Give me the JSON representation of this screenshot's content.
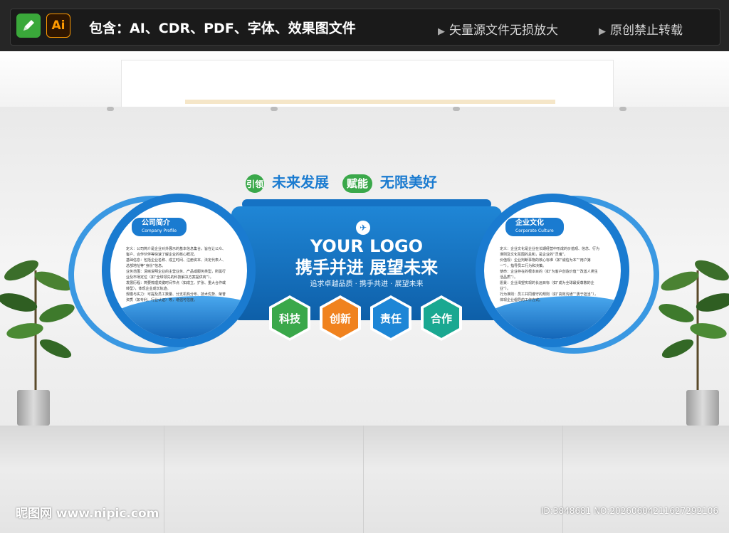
{
  "topbar": {
    "pen_icon": "pen-icon",
    "ai_label": "Ai",
    "contains": "包含：AI、CDR、PDF、字体、效果图文件",
    "feature1": "矢量源文件无损放大",
    "feature2": "原创禁止转载"
  },
  "headline": {
    "part1": "引领",
    "part2": "未来发展",
    "part3": "赋能",
    "part4": "无限美好"
  },
  "left_panel": {
    "title": "公司简介",
    "subtitle": "Company Profile",
    "lines": [
      "定义：公司简介是企业对外展示的基本信息集合，旨在让公众、",
      "客户、合作伙伴等快速了解企业的核心概况。",
      "基础信息：包括企业名称、成立时间、注册资本、法定代表人、",
      "总部地址等“身份”信息。",
      "业务范围：清晰说明企业的主营业务、产品或服务类型，所属行",
      "业及市场定位（如“全球领先的科技解决方案提供商”）。",
      "发展历程：简要梳理关键时间节点（如成立、扩张、重大合作或",
      "转型），体现企业成长轨迹。",
      "规模与实力：可提及员工数量、分支机构分布、技术优势、荣誉",
      "资质（如专利、行业认证）等，增强可信度。"
    ]
  },
  "right_panel": {
    "title": "企业文化",
    "subtitle": "Corporate Culture",
    "lines": [
      "定义：企业文化是企业在长期经营中形成的价值观、信念、行为",
      "准则及文化氛围的总和，是企业的“灵魂”。",
      "价值观：企业判断事物的核心标准（如“诚信为本”“用户第",
      "一”），指导员工行为和决策。",
      "使命：企业存在的根本目的（如“为客户创造价值”“改善人类生",
      "活品质”）。",
      "愿景：企业渴望实现的长远目标（如“成为全球最受尊敬的企",
      "业”）。",
      "行为准则：员工共同遵守的规则（如“高效沟通”“勇于担当”），",
      "体现企业倡导的工作方式。"
    ]
  },
  "center": {
    "logo_mark": "logo-icon",
    "logo": "YOUR LOGO",
    "slogan": "携手并进 展望未来",
    "sub": "追求卓越品质 · 携手共进 · 展望未来"
  },
  "values": [
    {
      "label": "科技",
      "color": "#3aa84a"
    },
    {
      "label": "创新",
      "color": "#f0821e"
    },
    {
      "label": "责任",
      "color": "#1d86d6"
    },
    {
      "label": "合作",
      "color": "#1aa891"
    }
  ],
  "footer": {
    "site": "昵图网 www.nipic.com",
    "id": "ID:3848681 NO:20260604211627292106"
  }
}
